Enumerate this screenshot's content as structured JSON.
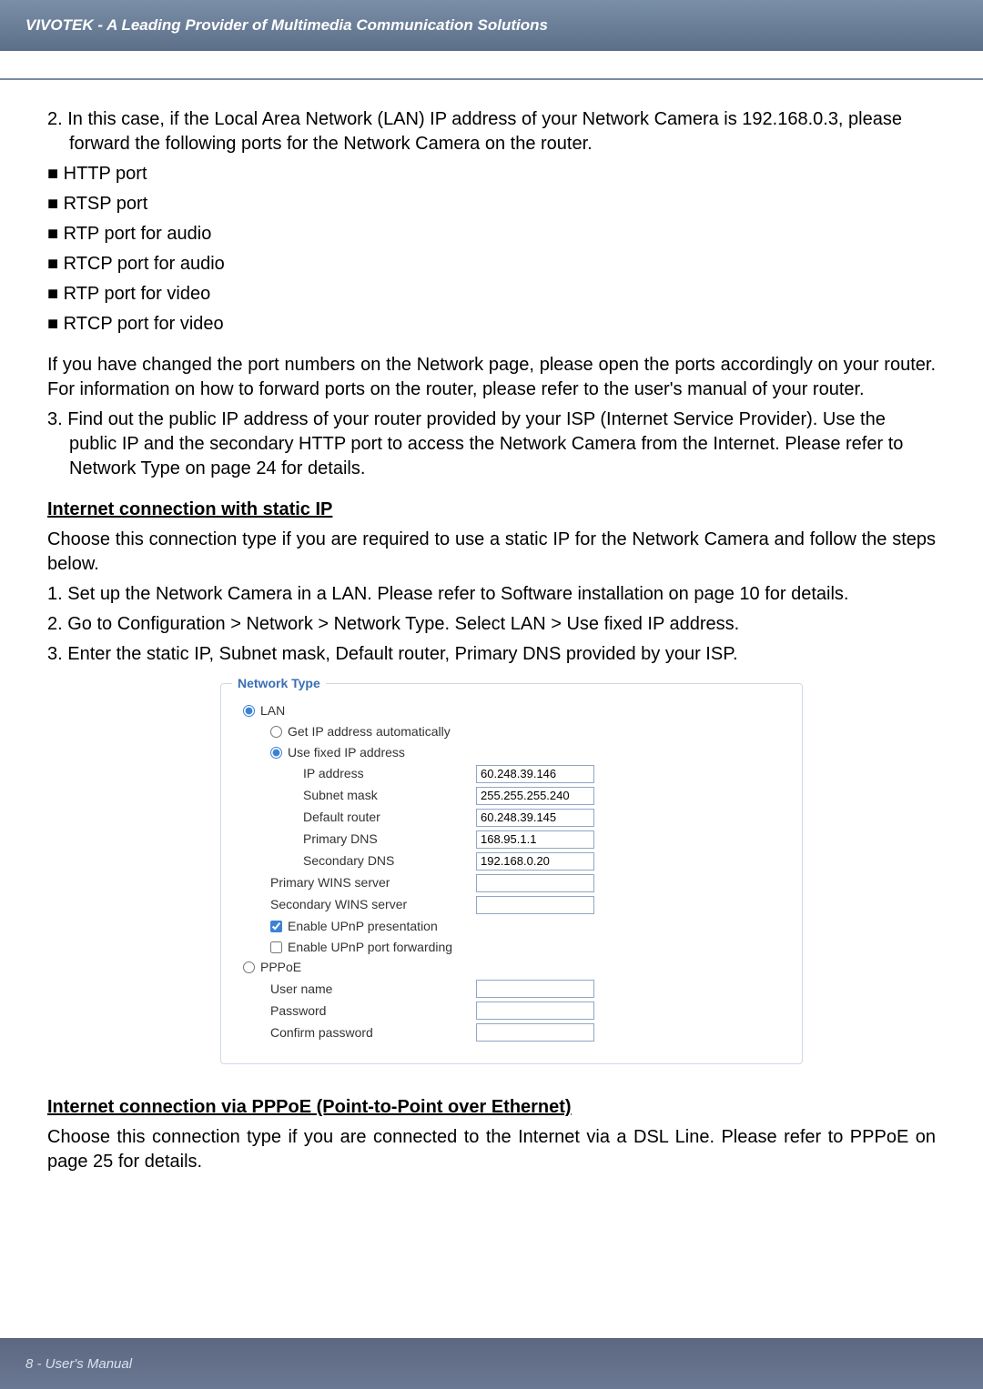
{
  "header": {
    "title": "VIVOTEK - A Leading Provider of Multimedia Communication Solutions"
  },
  "body": {
    "p1": "2. In this case, if the Local Area Network (LAN) IP address of your Network Camera is 192.168.0.3, please forward the following ports for the Network Camera on the router.",
    "ports": [
      "■ HTTP port",
      "■ RTSP port",
      "■ RTP port for audio",
      "■ RTCP port for audio",
      "■ RTP port for video",
      "■ RTCP port for video"
    ],
    "p2": "If you have changed the port numbers on the Network page, please open the ports accordingly on your router. For information on how to forward ports on the router, please refer to the user's manual of your router.",
    "p3": "3. Find out the public IP address of your router provided by your ISP (Internet Service Provider). Use the public IP and the secondary HTTP port to access the Network Camera from the Internet. Please refer to Network Type on page 24 for details.",
    "h1": "Internet connection with static IP",
    "p4": "Choose this connection type if you are required to use a static IP for the Network Camera and follow the steps below.",
    "steps": [
      "1. Set up the Network Camera in a LAN. Please refer to Software installation on page 10 for details.",
      "2. Go to Configuration > Network > Network Type. Select LAN > Use fixed IP address.",
      "3. Enter the static IP, Subnet mask, Default router, Primary DNS provided by your ISP."
    ],
    "nt": {
      "legend": "Network Type",
      "lan": "LAN",
      "get_auto": "Get IP address automatically",
      "use_fixed": "Use fixed IP address",
      "fields": {
        "ip_label": "IP address",
        "ip_val": "60.248.39.146",
        "subnet_label": "Subnet mask",
        "subnet_val": "255.255.255.240",
        "router_label": "Default router",
        "router_val": "60.248.39.145",
        "pdns_label": "Primary DNS",
        "pdns_val": "168.95.1.1",
        "sdns_label": "Secondary DNS",
        "sdns_val": "192.168.0.20",
        "pwins_label": "Primary WINS server",
        "pwins_val": "",
        "swins_label": "Secondary WINS server",
        "swins_val": ""
      },
      "upnp_pres": "Enable UPnP presentation",
      "upnp_fwd": "Enable UPnP port forwarding",
      "pppoe": "PPPoE",
      "user_label": "User name",
      "user_val": "",
      "pass_label": "Password",
      "pass_val": "",
      "cpass_label": "Confirm password",
      "cpass_val": ""
    },
    "h2": "Internet connection via PPPoE (Point-to-Point over Ethernet)",
    "p5": "Choose this connection type if you are connected to the Internet via a DSL Line. Please refer to PPPoE on page 25 for details."
  },
  "footer": {
    "text": "8 - User's Manual"
  }
}
